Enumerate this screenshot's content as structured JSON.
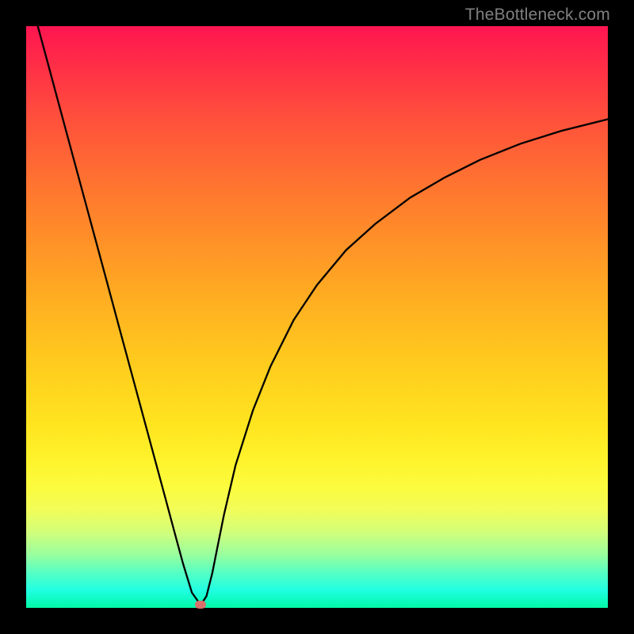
{
  "watermark": "TheBottleneck.com",
  "chart_data": {
    "type": "line",
    "title": "",
    "xlabel": "",
    "ylabel": "",
    "xlim": [
      0,
      100
    ],
    "ylim": [
      0,
      100
    ],
    "axes_visible": false,
    "background": "rainbow-gradient-vertical",
    "gradient_stops": [
      {
        "pos": 0.0,
        "color": "#ff1550"
      },
      {
        "pos": 0.35,
        "color": "#ff8b29"
      },
      {
        "pos": 0.68,
        "color": "#ffe31f"
      },
      {
        "pos": 0.87,
        "color": "#d2fe7b"
      },
      {
        "pos": 1.0,
        "color": "#00f8a7"
      }
    ],
    "series": [
      {
        "name": "bottleneck-curve",
        "x": [
          2,
          4,
          6,
          8,
          10,
          12,
          14,
          16,
          18,
          20,
          22,
          24,
          25.5,
          27,
          28.5,
          30,
          31,
          32,
          33,
          34,
          36,
          39,
          42,
          46,
          50,
          55,
          60,
          66,
          72,
          78,
          85,
          92,
          100
        ],
        "y": [
          100,
          92.6,
          85.2,
          77.8,
          70.4,
          63.0,
          55.6,
          48.2,
          40.8,
          33.4,
          26.0,
          18.6,
          13.0,
          7.5,
          2.6,
          0.5,
          2.0,
          6.0,
          11.0,
          16.0,
          24.5,
          34.0,
          41.5,
          49.5,
          55.5,
          61.5,
          66.0,
          70.5,
          74.0,
          77.0,
          79.8,
          82.0,
          84.0
        ],
        "color": "#000000"
      }
    ],
    "marker": {
      "x": 30,
      "y": 0.5,
      "color": "#d9706c",
      "shape": "rounded-rect"
    }
  }
}
